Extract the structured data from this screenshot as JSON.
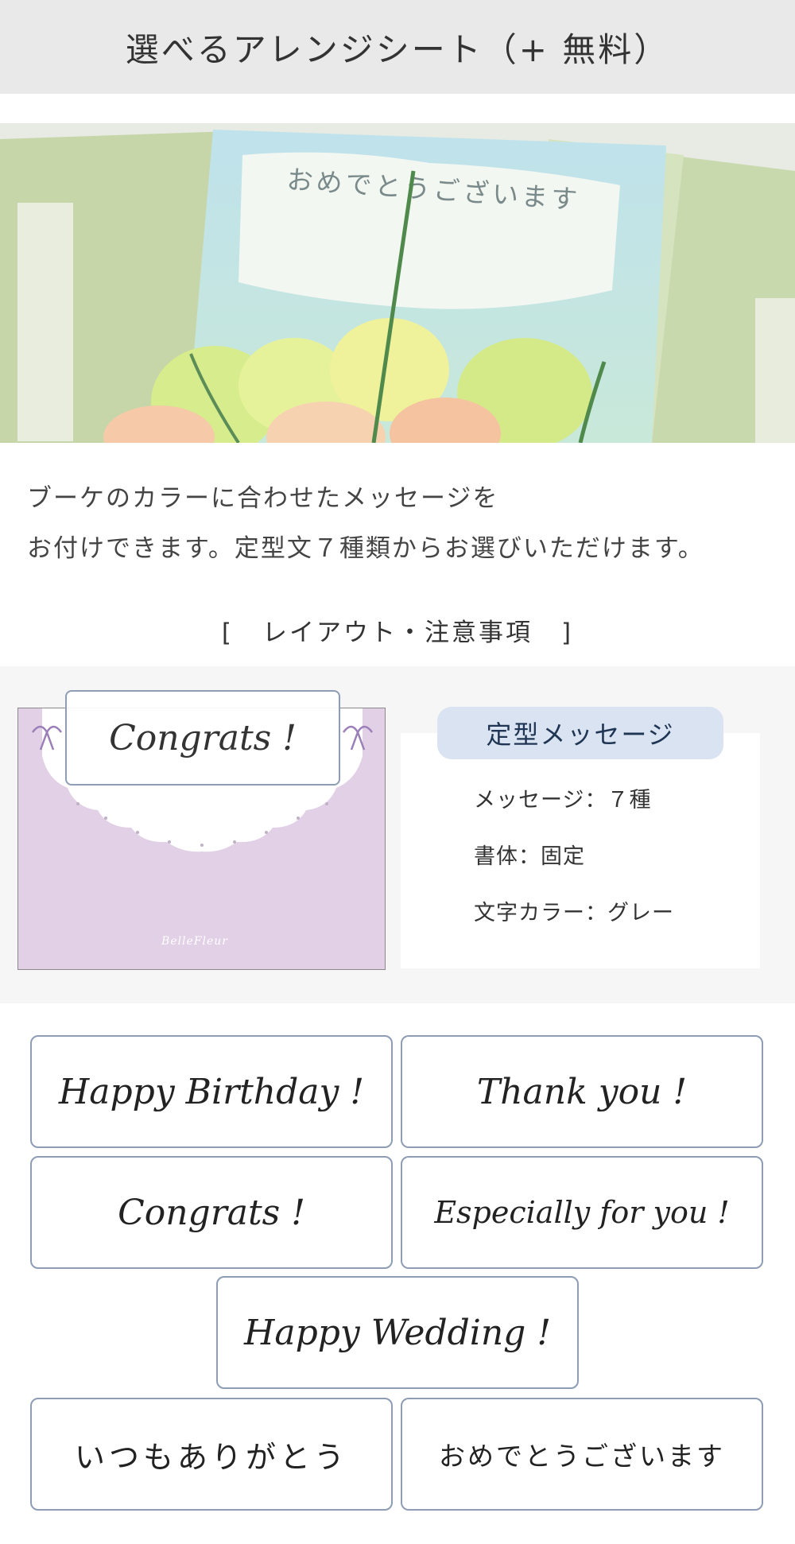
{
  "header": {
    "title": "選べるアレンジシート（+ 無料）"
  },
  "hero": {
    "card_text": "おめでとうございます"
  },
  "description": {
    "line1": "ブーケのカラーに合わせたメッセージを",
    "line2": "お付けできます。定型文７種類からお選びいただけます。"
  },
  "layout_section": {
    "open_bracket": "[",
    "title": "レイアウト・注意事項",
    "close_bracket": "]"
  },
  "preview": {
    "label": "Congrats !",
    "logo": "BelleFleur"
  },
  "spec": {
    "badge": "定型メッセージ",
    "lines": [
      "メッセージ：７種",
      "書体：固定",
      "文字カラー：グレー"
    ]
  },
  "messages": [
    "Happy Birthday !",
    "Thank you !",
    "Congrats !",
    "Especially for you !",
    "Happy Wedding !",
    "いつもありがとう",
    "おめでとうございます"
  ],
  "colors": {
    "header_bg": "#e9e9e9",
    "panel_bg": "#f6f6f6",
    "badge_bg": "#d9e3f1",
    "box_border": "#8d9db3",
    "card_lavender": "#e1d0e6"
  }
}
